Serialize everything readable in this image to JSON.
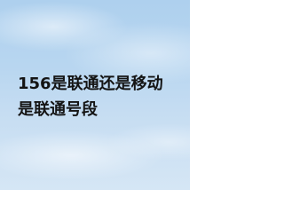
{
  "headline": {
    "line1": "156是联通还是移动",
    "line2": "是联通号段"
  }
}
